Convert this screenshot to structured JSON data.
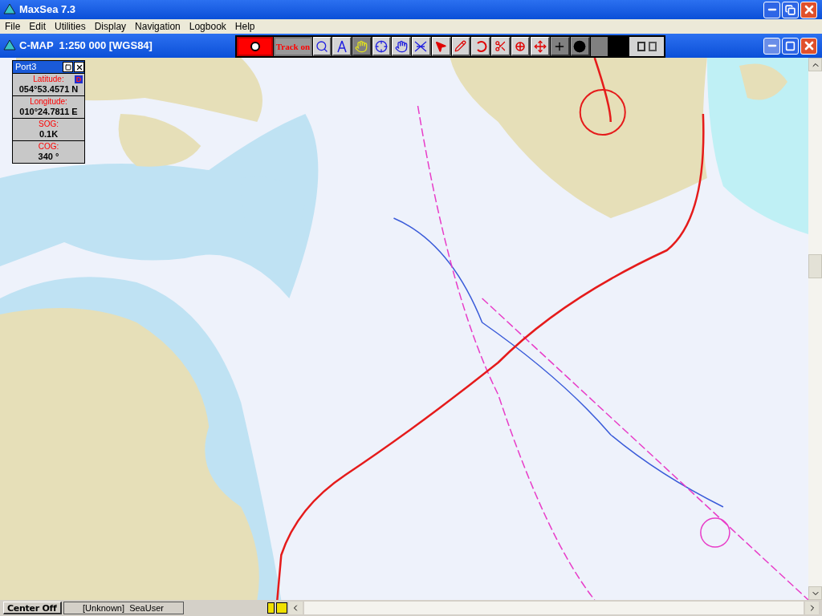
{
  "window": {
    "title": "MaxSea 7.3"
  },
  "menu": [
    "File",
    "Edit",
    "Utilities",
    "Display",
    "Navigation",
    "Logbook",
    "Help"
  ],
  "chart_window": {
    "title": "C-MAP  1:250 000 [WGS84]"
  },
  "toolbar": {
    "track_button": "Track on"
  },
  "port_panel": {
    "title": "Port3",
    "badge": "D",
    "fields": [
      {
        "label": "Latitude:",
        "value": "054°53.4571 N"
      },
      {
        "label": "Longitude:",
        "value": "010°24.7811 E"
      },
      {
        "label": "SOG:",
        "value": "0.1K"
      },
      {
        "label": "COG:",
        "value": "340 °"
      }
    ]
  },
  "status_bar": {
    "center_button": "Center Off",
    "user": "[Unknown]  SeaUser"
  }
}
